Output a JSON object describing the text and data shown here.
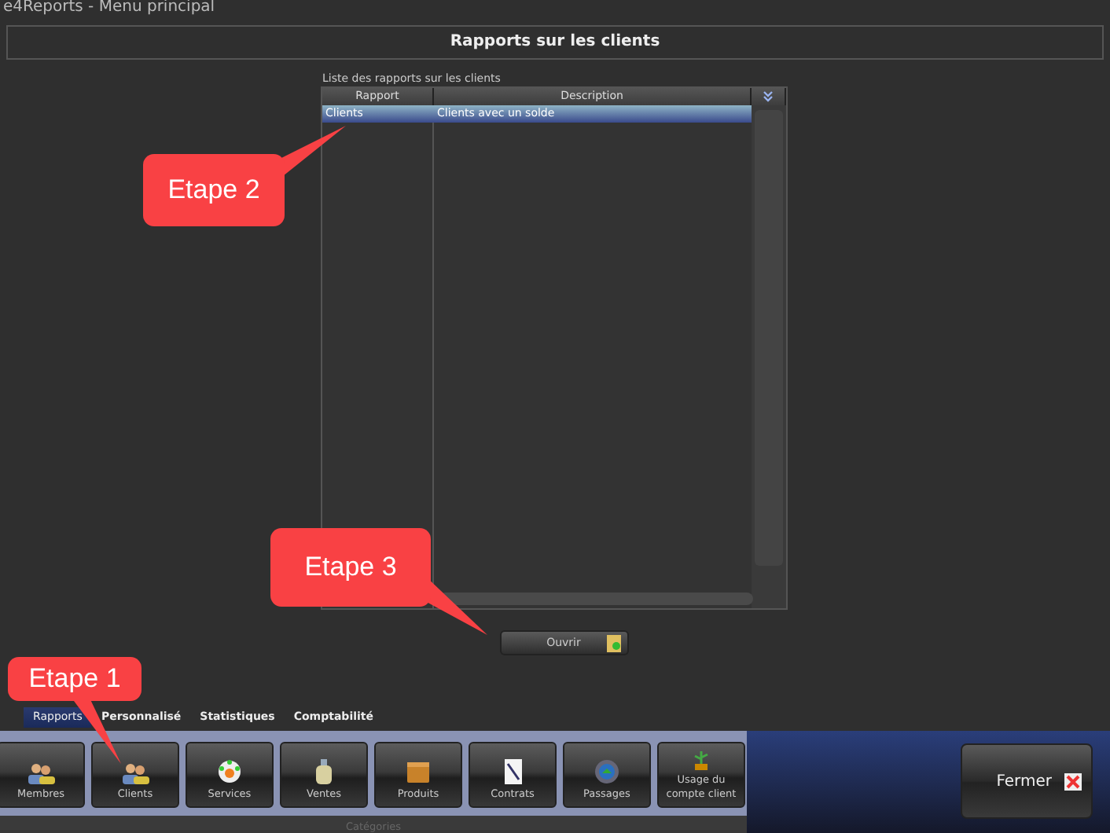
{
  "window": {
    "title": "e4Reports - Menu principal"
  },
  "header": {
    "title": "Rapports sur les clients"
  },
  "report_list": {
    "label": "Liste des rapports sur les clients",
    "columns": [
      "Rapport",
      "Description"
    ],
    "rows": [
      {
        "cells": [
          "Clients",
          "Clients avec un solde"
        ],
        "selected": true
      }
    ]
  },
  "open_button": {
    "label": "Ouvrir"
  },
  "tabs": [
    {
      "label": "Rapports",
      "selected": true
    },
    {
      "label": "Personnalisé",
      "selected": false
    },
    {
      "label": "Statistiques",
      "selected": false
    },
    {
      "label": "Comptabilité",
      "selected": false
    }
  ],
  "categories": {
    "label": "Catégories",
    "items": [
      {
        "label": "Membres",
        "kind": "people"
      },
      {
        "label": "Clients",
        "kind": "people"
      },
      {
        "label": "Services",
        "kind": "wheel"
      },
      {
        "label": "Ventes",
        "kind": "bottle"
      },
      {
        "label": "Produits",
        "kind": "box"
      },
      {
        "label": "Contrats",
        "kind": "document"
      },
      {
        "label": "Passages",
        "kind": "globe"
      },
      {
        "label": "Usage du compte client",
        "kind": "plant"
      }
    ]
  },
  "close_button": {
    "label": "Fermer"
  },
  "callouts": [
    {
      "text": "Etape 2"
    },
    {
      "text": "Etape 3"
    },
    {
      "text": "Etape 1"
    }
  ]
}
